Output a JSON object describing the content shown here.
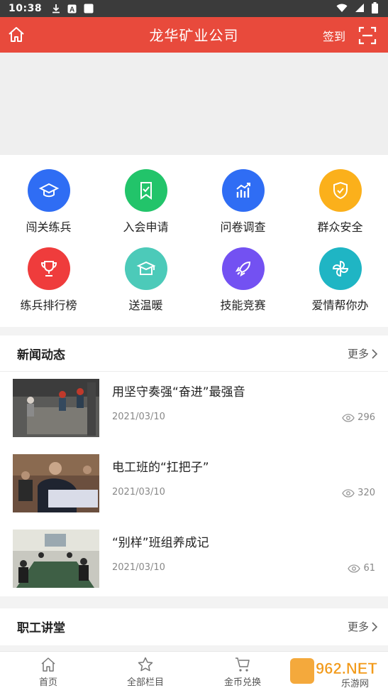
{
  "status": {
    "time": "10:38"
  },
  "header": {
    "title": "龙华矿业公司",
    "signin_label": "签到"
  },
  "colors": {
    "accent": "#e84a3c"
  },
  "features": [
    {
      "label": "闯关练兵",
      "icon": "graduation-cap-icon",
      "color": "#2f6df4"
    },
    {
      "label": "入会申请",
      "icon": "bookmark-check-icon",
      "color": "#22c46a"
    },
    {
      "label": "问卷调查",
      "icon": "bar-chart-trend-icon",
      "color": "#2f6df4"
    },
    {
      "label": "群众安全",
      "icon": "shield-check-icon",
      "color": "#fbb01b"
    },
    {
      "label": "练兵排行榜",
      "icon": "trophy-icon",
      "color": "#ef3c3c"
    },
    {
      "label": "送温暖",
      "icon": "graduation-box-icon",
      "color": "#4ccab9"
    },
    {
      "label": "技能竞赛",
      "icon": "rocket-icon",
      "color": "#7351f2"
    },
    {
      "label": "爱情帮你办",
      "icon": "pinwheel-icon",
      "color": "#1fb5c4"
    }
  ],
  "news_section": {
    "title": "新闻动态",
    "more_label": "更多",
    "items": [
      {
        "title": "用坚守奏强“奋进”最强音",
        "date": "2021/03/10",
        "views": "296"
      },
      {
        "title": "电工班的“扛把子”",
        "date": "2021/03/10",
        "views": "320"
      },
      {
        "title": "“别样”班组养成记",
        "date": "2021/03/10",
        "views": "61"
      }
    ]
  },
  "lecture_section": {
    "title": "职工讲堂",
    "more_label": "更多"
  },
  "tabs": [
    {
      "label": "首页"
    },
    {
      "label": "全部栏目"
    },
    {
      "label": "金币兑换"
    }
  ],
  "watermark": {
    "text": "962.NET",
    "sub": "乐游网"
  }
}
